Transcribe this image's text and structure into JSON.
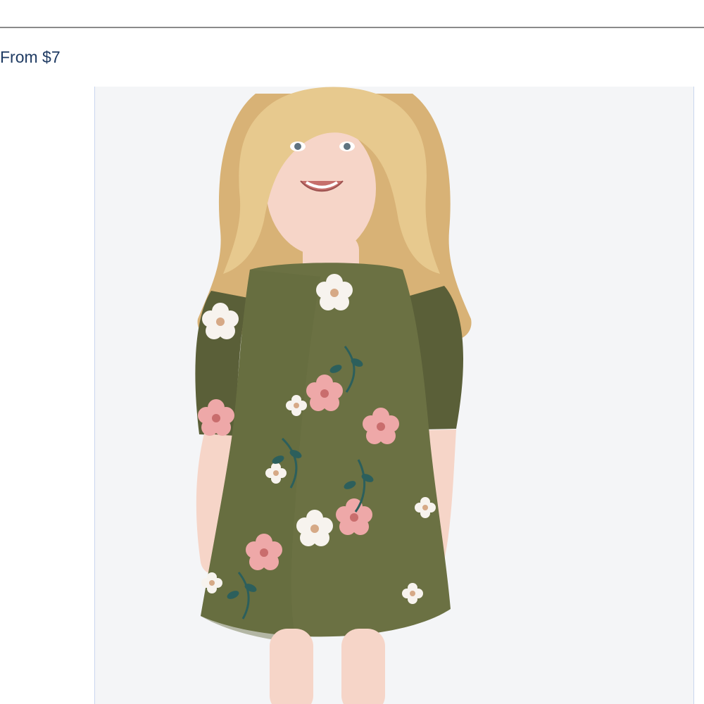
{
  "listing": {
    "price_label": "From $7"
  },
  "product_image": {
    "subject": "toddler-floral-dress",
    "colors": {
      "background": "#f4f5f7",
      "dress": "#6b7143",
      "dress_shadow": "#5a5f38",
      "hair": "#e7c98e",
      "hair_shade": "#d8b276",
      "skin": "#f6d5c8",
      "flower_white": "#f7f3ee",
      "flower_pink": "#eea8a8",
      "leaf": "#2c5f5c"
    }
  }
}
